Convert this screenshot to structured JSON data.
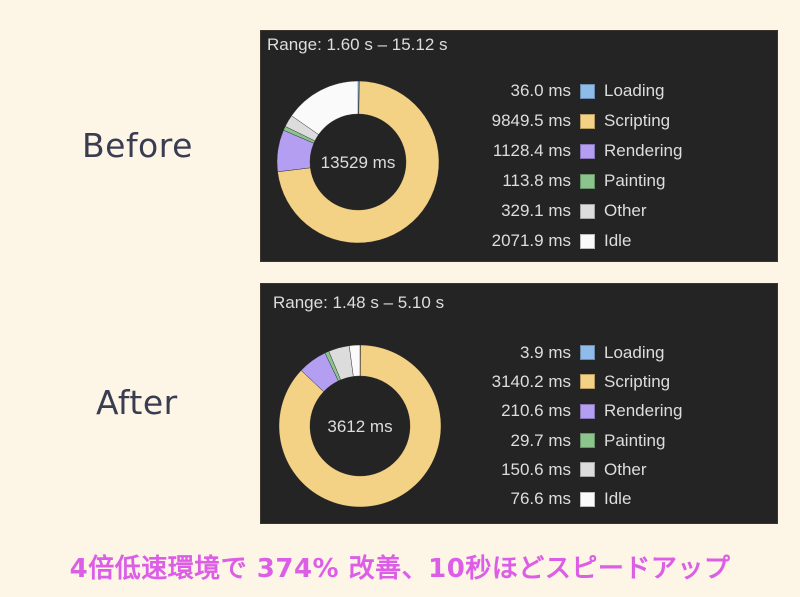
{
  "labels": {
    "before": "Before",
    "after": "After"
  },
  "caption": "4倍低速環境で 374% 改善、10秒ほどスピードアップ",
  "colors": {
    "Loading": "#8ebbe9",
    "Scripting": "#f3d185",
    "Rendering": "#b49ef2",
    "Painting": "#8bc58b",
    "Other": "#dcdcdc",
    "Idle": "#fafafa"
  },
  "chart_data": [
    {
      "type": "pie",
      "variant": "donut",
      "name": "Before",
      "title": "Range: 1.60 s – 15.12 s",
      "center_label": "13529 ms",
      "unit": "ms",
      "start_angle": "12 o'clock, clockwise",
      "legend_position": "right",
      "categories": [
        "Loading",
        "Scripting",
        "Rendering",
        "Painting",
        "Other",
        "Idle"
      ],
      "values": [
        36.0,
        9849.5,
        1128.4,
        113.8,
        329.1,
        2071.9
      ],
      "value_labels": [
        "36.0 ms",
        "9849.5 ms",
        "1128.4 ms",
        "113.8 ms",
        "329.1 ms",
        "2071.9 ms"
      ]
    },
    {
      "type": "pie",
      "variant": "donut",
      "name": "After",
      "title": "Range: 1.48 s – 5.10 s",
      "center_label": "3612 ms",
      "unit": "ms",
      "start_angle": "12 o'clock, clockwise",
      "legend_position": "right",
      "categories": [
        "Loading",
        "Scripting",
        "Rendering",
        "Painting",
        "Other",
        "Idle"
      ],
      "values": [
        3.9,
        3140.2,
        210.6,
        29.7,
        150.6,
        76.6
      ],
      "value_labels": [
        "3.9 ms",
        "3140.2 ms",
        "210.6 ms",
        "29.7 ms",
        "150.6 ms",
        "76.6 ms"
      ]
    }
  ]
}
